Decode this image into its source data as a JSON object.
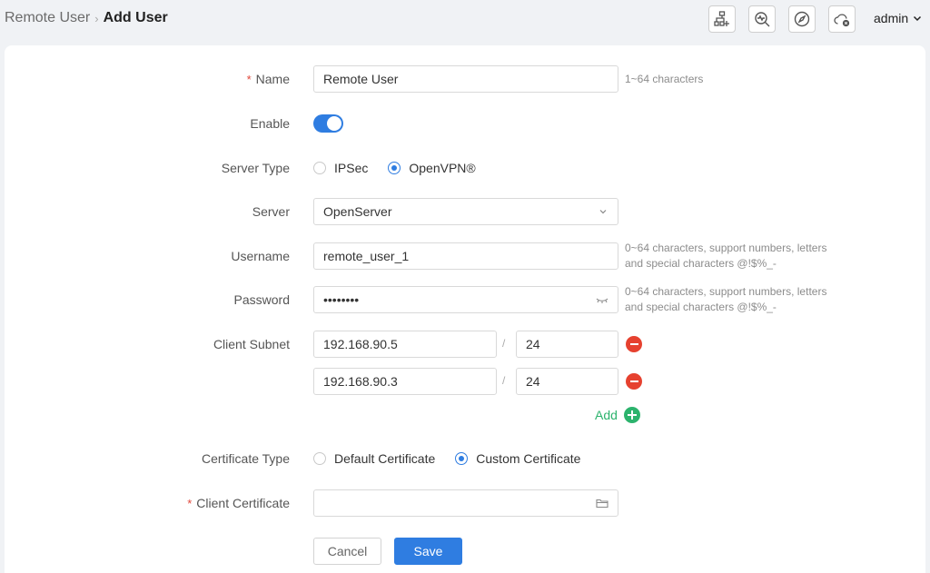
{
  "breadcrumb": {
    "parent": "Remote User",
    "separator": "›",
    "current": "Add User"
  },
  "header_icons": [
    "network-add-icon",
    "diagnose-icon",
    "compass-icon",
    "cloud-icon"
  ],
  "user": {
    "name": "admin"
  },
  "form": {
    "name": {
      "label": "Name",
      "value": "Remote User",
      "hint": "1~64 characters",
      "required": true
    },
    "enable": {
      "label": "Enable",
      "on": true
    },
    "server_type": {
      "label": "Server Type",
      "options": [
        "IPSec",
        "OpenVPN®"
      ],
      "selected": "OpenVPN®"
    },
    "server": {
      "label": "Server",
      "value": "OpenServer"
    },
    "username": {
      "label": "Username",
      "value": "remote_user_1",
      "hint": "0~64 characters, support numbers, letters and special characters @!$%_-"
    },
    "password": {
      "label": "Password",
      "value": "••••••••",
      "hint": "0~64 characters, support numbers, letters and special characters @!$%_-"
    },
    "client_subnet": {
      "label": "Client Subnet",
      "separator": "/",
      "entries": [
        {
          "ip": "192.168.90.5",
          "mask": "24"
        },
        {
          "ip": "192.168.90.3",
          "mask": "24"
        }
      ],
      "add_label": "Add"
    },
    "certificate_type": {
      "label": "Certificate Type",
      "options": [
        "Default Certificate",
        "Custom Certificate"
      ],
      "selected": "Custom Certificate"
    },
    "client_certificate": {
      "label": "Client Certificate",
      "value": "",
      "required": true
    }
  },
  "buttons": {
    "cancel": "Cancel",
    "save": "Save"
  },
  "colors": {
    "primary": "#2f7de1",
    "danger": "#e6412f",
    "success": "#2cb36d",
    "required": "#e0463a"
  }
}
